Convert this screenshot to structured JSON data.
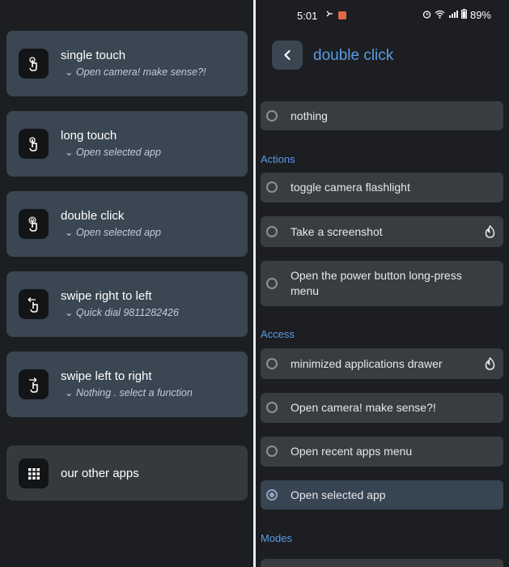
{
  "left": {
    "gestures": [
      {
        "title": "single touch",
        "action": "Open camera! make sense?!",
        "icon": "tap-icon"
      },
      {
        "title": "long touch",
        "action": "Open selected app",
        "icon": "long-press-icon"
      },
      {
        "title": "double click",
        "action": "Open selected app",
        "icon": "double-tap-icon"
      },
      {
        "title": "swipe right to left",
        "action": "Quick dial 9811282426",
        "icon": "swipe-left-icon"
      },
      {
        "title": "swipe left to right",
        "action": "Nothing . select a function",
        "icon": "swipe-right-icon"
      }
    ],
    "other_apps": "our other apps"
  },
  "right": {
    "status": {
      "time": "5:01",
      "battery": "89%"
    },
    "header": {
      "title": "double click"
    },
    "sections": {
      "actions": "Actions",
      "access": "Access",
      "modes": "Modes"
    },
    "options": [
      {
        "label": "nothing",
        "selected": false
      },
      {
        "label": "toggle camera flashlight",
        "selected": false
      },
      {
        "label": "Take a screenshot",
        "selected": false,
        "badge": "fire-icon"
      },
      {
        "label": "Open the power button long-press menu",
        "selected": false
      },
      {
        "label": "minimized applications drawer",
        "selected": false,
        "badge": "fire-icon"
      },
      {
        "label": "Open camera! make sense?!",
        "selected": false
      },
      {
        "label": "Open recent apps menu",
        "selected": false
      },
      {
        "label": "Open selected app",
        "selected": true
      }
    ]
  },
  "colors": {
    "accent": "#5b9be6",
    "card": "#3a4652",
    "option": "#3a3d40",
    "flame": "#e8e8e8"
  }
}
